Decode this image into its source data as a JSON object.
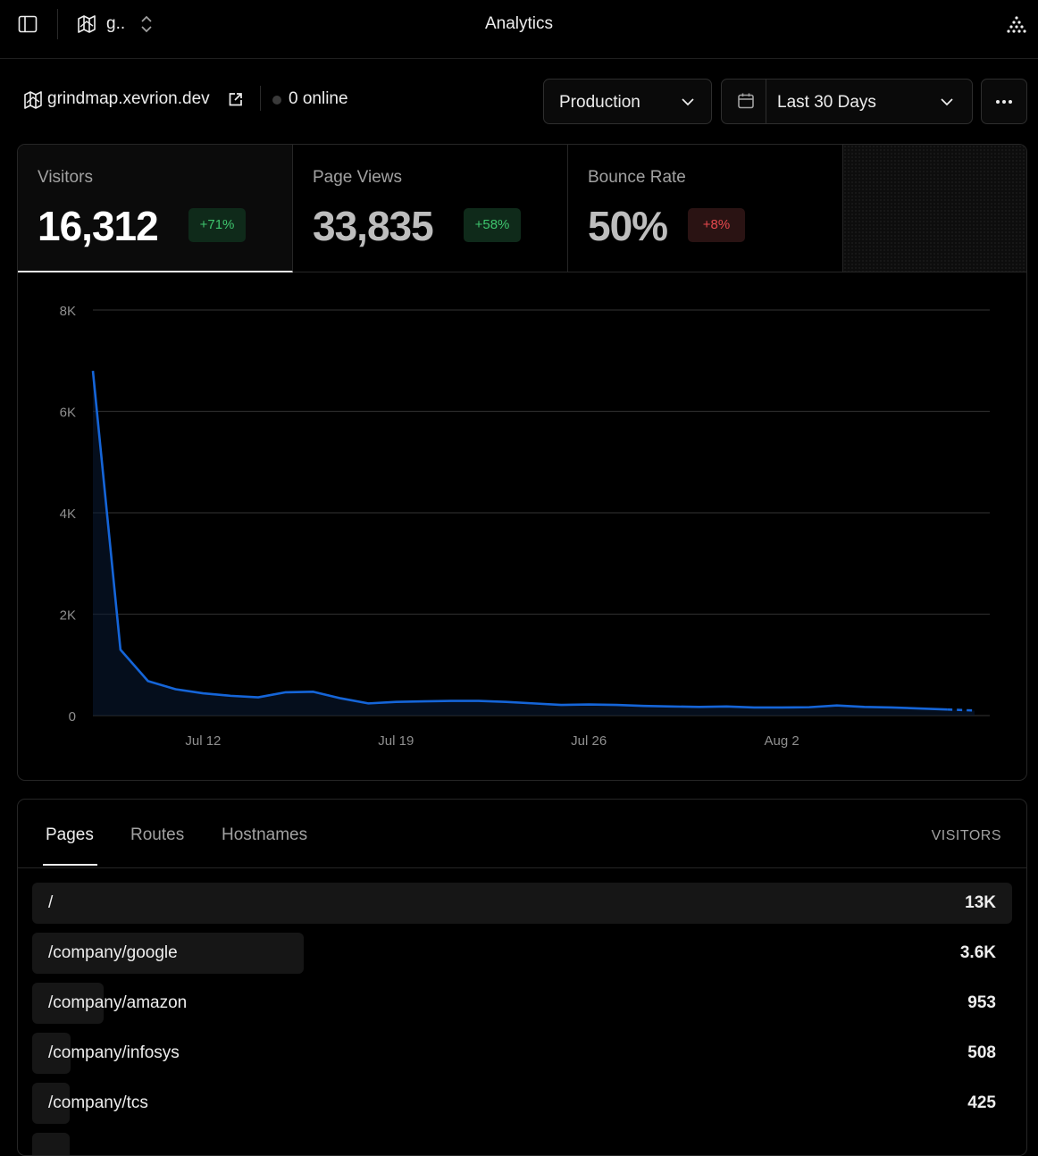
{
  "topbar": {
    "project_name": "g..",
    "title": "Analytics"
  },
  "site": {
    "domain": "grindmap.xevrion.dev",
    "online": "0 online"
  },
  "filters": {
    "environment": "Production",
    "range": "Last 30 Days"
  },
  "metrics": [
    {
      "label": "Visitors",
      "value": "16,312",
      "change": "+71%",
      "trend": "up",
      "active": true
    },
    {
      "label": "Page Views",
      "value": "33,835",
      "change": "+58%",
      "trend": "up",
      "active": false
    },
    {
      "label": "Bounce Rate",
      "value": "50%",
      "change": "+8%",
      "trend": "down",
      "active": false
    }
  ],
  "colors": {
    "line": "#1565d8",
    "positive": "#3ec46d",
    "negative": "#e5484d"
  },
  "chart_data": {
    "type": "line",
    "series_name": "Visitors",
    "x": [
      "Jul 8",
      "Jul 9",
      "Jul 10",
      "Jul 11",
      "Jul 12",
      "Jul 13",
      "Jul 14",
      "Jul 15",
      "Jul 16",
      "Jul 17",
      "Jul 18",
      "Jul 19",
      "Jul 20",
      "Jul 21",
      "Jul 22",
      "Jul 23",
      "Jul 24",
      "Jul 25",
      "Jul 26",
      "Jul 27",
      "Jul 28",
      "Jul 29",
      "Jul 30",
      "Jul 31",
      "Aug 1",
      "Aug 2",
      "Aug 3",
      "Aug 4",
      "Aug 5",
      "Aug 6",
      "Aug 7",
      "Aug 8",
      "Aug 9"
    ],
    "values": [
      6800,
      1300,
      680,
      520,
      440,
      390,
      360,
      460,
      470,
      340,
      240,
      270,
      280,
      290,
      290,
      270,
      240,
      210,
      220,
      210,
      190,
      180,
      170,
      180,
      160,
      160,
      165,
      200,
      170,
      160,
      140,
      120,
      100
    ],
    "partial_from_index": 31,
    "x_ticks": [
      "Jul 12",
      "Jul 19",
      "Jul 26",
      "Aug 2"
    ],
    "y_ticks": [
      "0",
      "2K",
      "4K",
      "6K",
      "8K"
    ],
    "ylim": [
      0,
      8000
    ],
    "grid": true
  },
  "pages": {
    "tabs": [
      "Pages",
      "Routes",
      "Hostnames"
    ],
    "active_tab": 0,
    "column_header": "VISITORS",
    "rows": [
      {
        "path": "/",
        "visitors": "13K",
        "count": 13000
      },
      {
        "path": "/company/google",
        "visitors": "3.6K",
        "count": 3600
      },
      {
        "path": "/company/amazon",
        "visitors": "953",
        "count": 953
      },
      {
        "path": "/company/infosys",
        "visitors": "508",
        "count": 508
      },
      {
        "path": "/company/tcs",
        "visitors": "425",
        "count": 425
      },
      {
        "path": "",
        "visitors": "",
        "count": 300
      }
    ]
  }
}
